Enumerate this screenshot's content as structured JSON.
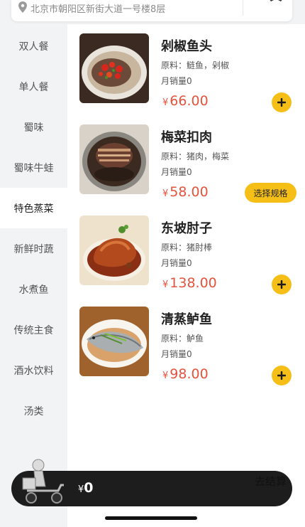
{
  "header": {
    "address": "北京市朝阳区新街大道一号楼8层",
    "location_icon": "location-pin-icon",
    "phone_icon": "phone-icon"
  },
  "categories": [
    {
      "label": "双人餐",
      "active": false
    },
    {
      "label": "单人餐",
      "active": false
    },
    {
      "label": "蜀味",
      "active": false
    },
    {
      "label": "蜀味牛蛙",
      "active": false
    },
    {
      "label": "特色蒸菜",
      "active": true
    },
    {
      "label": "新鲜时蔬",
      "active": false
    },
    {
      "label": "水煮鱼",
      "active": false
    },
    {
      "label": "传统主食",
      "active": false
    },
    {
      "label": "酒水饮料",
      "active": false
    },
    {
      "label": "汤类",
      "active": false
    }
  ],
  "items": [
    {
      "name": "剁椒鱼头",
      "ingredients": "原料：鲢鱼，剁椒",
      "sales": "月销量0",
      "currency": "¥",
      "price": "66.00",
      "action": "add",
      "action_icon": "plus-icon"
    },
    {
      "name": "梅菜扣肉",
      "ingredients": "原料：猪肉，梅菜",
      "sales": "月销量0",
      "currency": "¥",
      "price": "58.00",
      "action": "spec",
      "action_label": "选择规格"
    },
    {
      "name": "东坡肘子",
      "ingredients": "原料：猪肘棒",
      "sales": "月销量0",
      "currency": "¥",
      "price": "138.00",
      "action": "add",
      "action_icon": "plus-icon"
    },
    {
      "name": "清蒸鲈鱼",
      "ingredients": "原料：鲈鱼",
      "sales": "月销量0",
      "currency": "¥",
      "price": "98.00",
      "action": "add",
      "action_icon": "plus-icon"
    }
  ],
  "cart": {
    "currency": "¥",
    "total": "0",
    "checkout_label": "去结算",
    "illustration": "delivery-scooter-icon"
  },
  "colors": {
    "accent": "#f6bf18",
    "price": "#e5533d",
    "sidebar_bg": "#f2f3f5",
    "cart_bg": "#1d1d1d"
  }
}
